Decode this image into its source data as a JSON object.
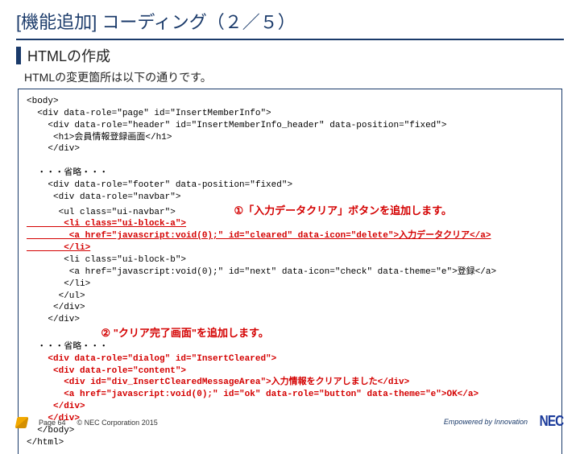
{
  "title": "[機能追加] コーディング（２／５）",
  "section": "HTMLの作成",
  "subtext": "HTMLの変更箇所は以下の通りです。",
  "code": {
    "l01": "<body>",
    "l02": "  <div data-role=\"page\" id=\"InsertMemberInfo\">",
    "l03": "    <div data-role=\"header\" id=\"InsertMemberInfo_header\" data-position=\"fixed\">",
    "l04": "     <h1>会員情報登録画面</h1>",
    "l05": "    </div>",
    "l06": "",
    "l07": "  ・・・省略・・・",
    "l08": "    <div data-role=\"footer\" data-position=\"fixed\">",
    "l09": "     <div data-role=\"navbar\">",
    "l10": "      <ul class=\"ui-navbar\">",
    "note1": "①「入力データクリア」ボタンを追加します。",
    "l11a": "       <li class=\"ui-block-a\">",
    "l11b": "        <a href=\"javascript:void(0);\" id=\"cleared\" data-icon=\"delete\">入力データクリア</a>",
    "l11c": "       </li>",
    "l12": "       <li class=\"ui-block-b\">",
    "l13": "        <a href=\"javascript:void(0);\" id=\"next\" data-icon=\"check\" data-theme=\"e\">登録</a>",
    "l14": "       </li>",
    "l15": "      </ul>",
    "l16": "     </div>",
    "l17": "    </div>",
    "note2": "② \"クリア完了画面\"を追加します。",
    "l18": "  ・・・省略・・・",
    "l19": "    <div data-role=\"dialog\" id=\"InsertCleared\">",
    "l20": "     <div data-role=\"content\">",
    "l21": "       <div id=\"div_InsertClearedMessageArea\">入力情報をクリアしました</div>",
    "l22": "       <a href=\"javascript:void(0);\" id=\"ok\" data-role=\"button\" data-theme=\"e\">OK</a>",
    "l23": "     </div>",
    "l24": "    </div>",
    "l25": "  </body>",
    "l26": "</html>"
  },
  "footer": {
    "page": "Page 64",
    "copyright": "© NEC Corporation 2015"
  },
  "brand": {
    "tagline": "Empowered by Innovation",
    "logo": "NEC"
  }
}
